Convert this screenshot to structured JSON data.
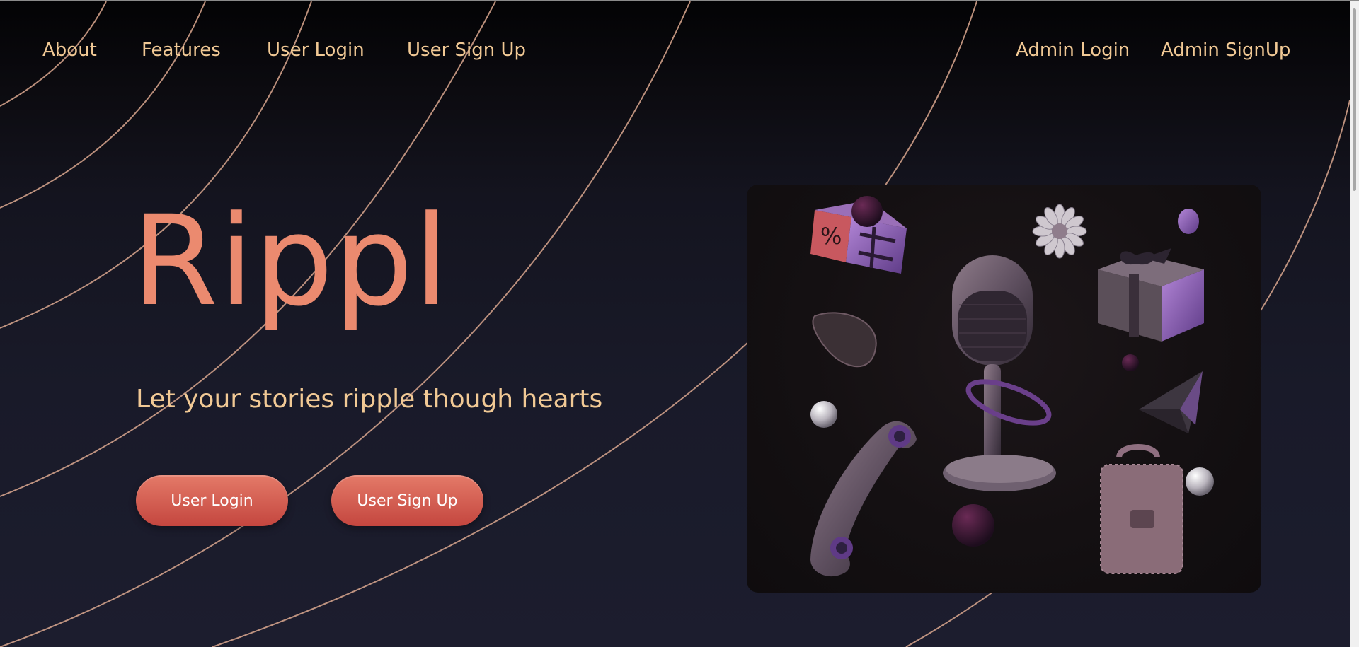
{
  "nav": {
    "about": "About",
    "features": "Features",
    "user_login": "User Login",
    "user_signup": "User Sign Up",
    "admin_login": "Admin Login",
    "admin_signup": "Admin SignUp"
  },
  "hero": {
    "title": "Rippl",
    "tagline": "Let your stories ripple though hearts",
    "cta_login": "User Login",
    "cta_signup": "User Sign Up"
  },
  "illustration": {
    "icons": [
      "discount-box-icon",
      "flower-icon",
      "gift-box-icon",
      "microphone-icon",
      "guitar-pick-icon",
      "paper-plane-icon",
      "telephone-handset-icon",
      "briefcase-icon",
      "glass-sphere-icon"
    ]
  },
  "colors": {
    "nav_text": "#f1c995",
    "title": "#eb8a6f",
    "tagline": "#f1c995",
    "button": "#d2584c",
    "arc": "#d9a184",
    "card": "#151113"
  }
}
